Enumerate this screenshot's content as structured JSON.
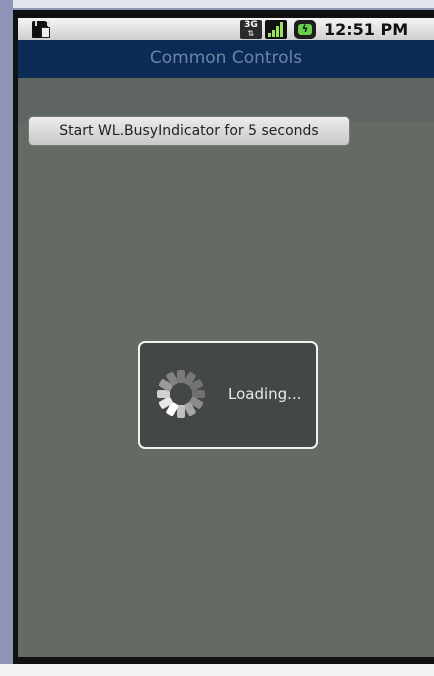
{
  "status_bar": {
    "network_type": "3G",
    "time": "12:51 PM",
    "icons": [
      "sd-card-icon",
      "3g-data-icon",
      "signal-strength-icon",
      "battery-charging-icon"
    ]
  },
  "header": {
    "title": "Common Controls"
  },
  "toolbar": {
    "start_button_label": "Start WL.BusyIndicator for 5 seconds"
  },
  "busy_indicator": {
    "text": "Loading...",
    "spinner_icon": "loading-spinner-icon"
  },
  "colors": {
    "title_bar": "#0b2a56",
    "title_text": "#6d84a5",
    "content_background": "#666a65",
    "overlay_background": "#444845",
    "overlay_border": "#f0f0f0",
    "device_frame": "#8f94b8"
  }
}
